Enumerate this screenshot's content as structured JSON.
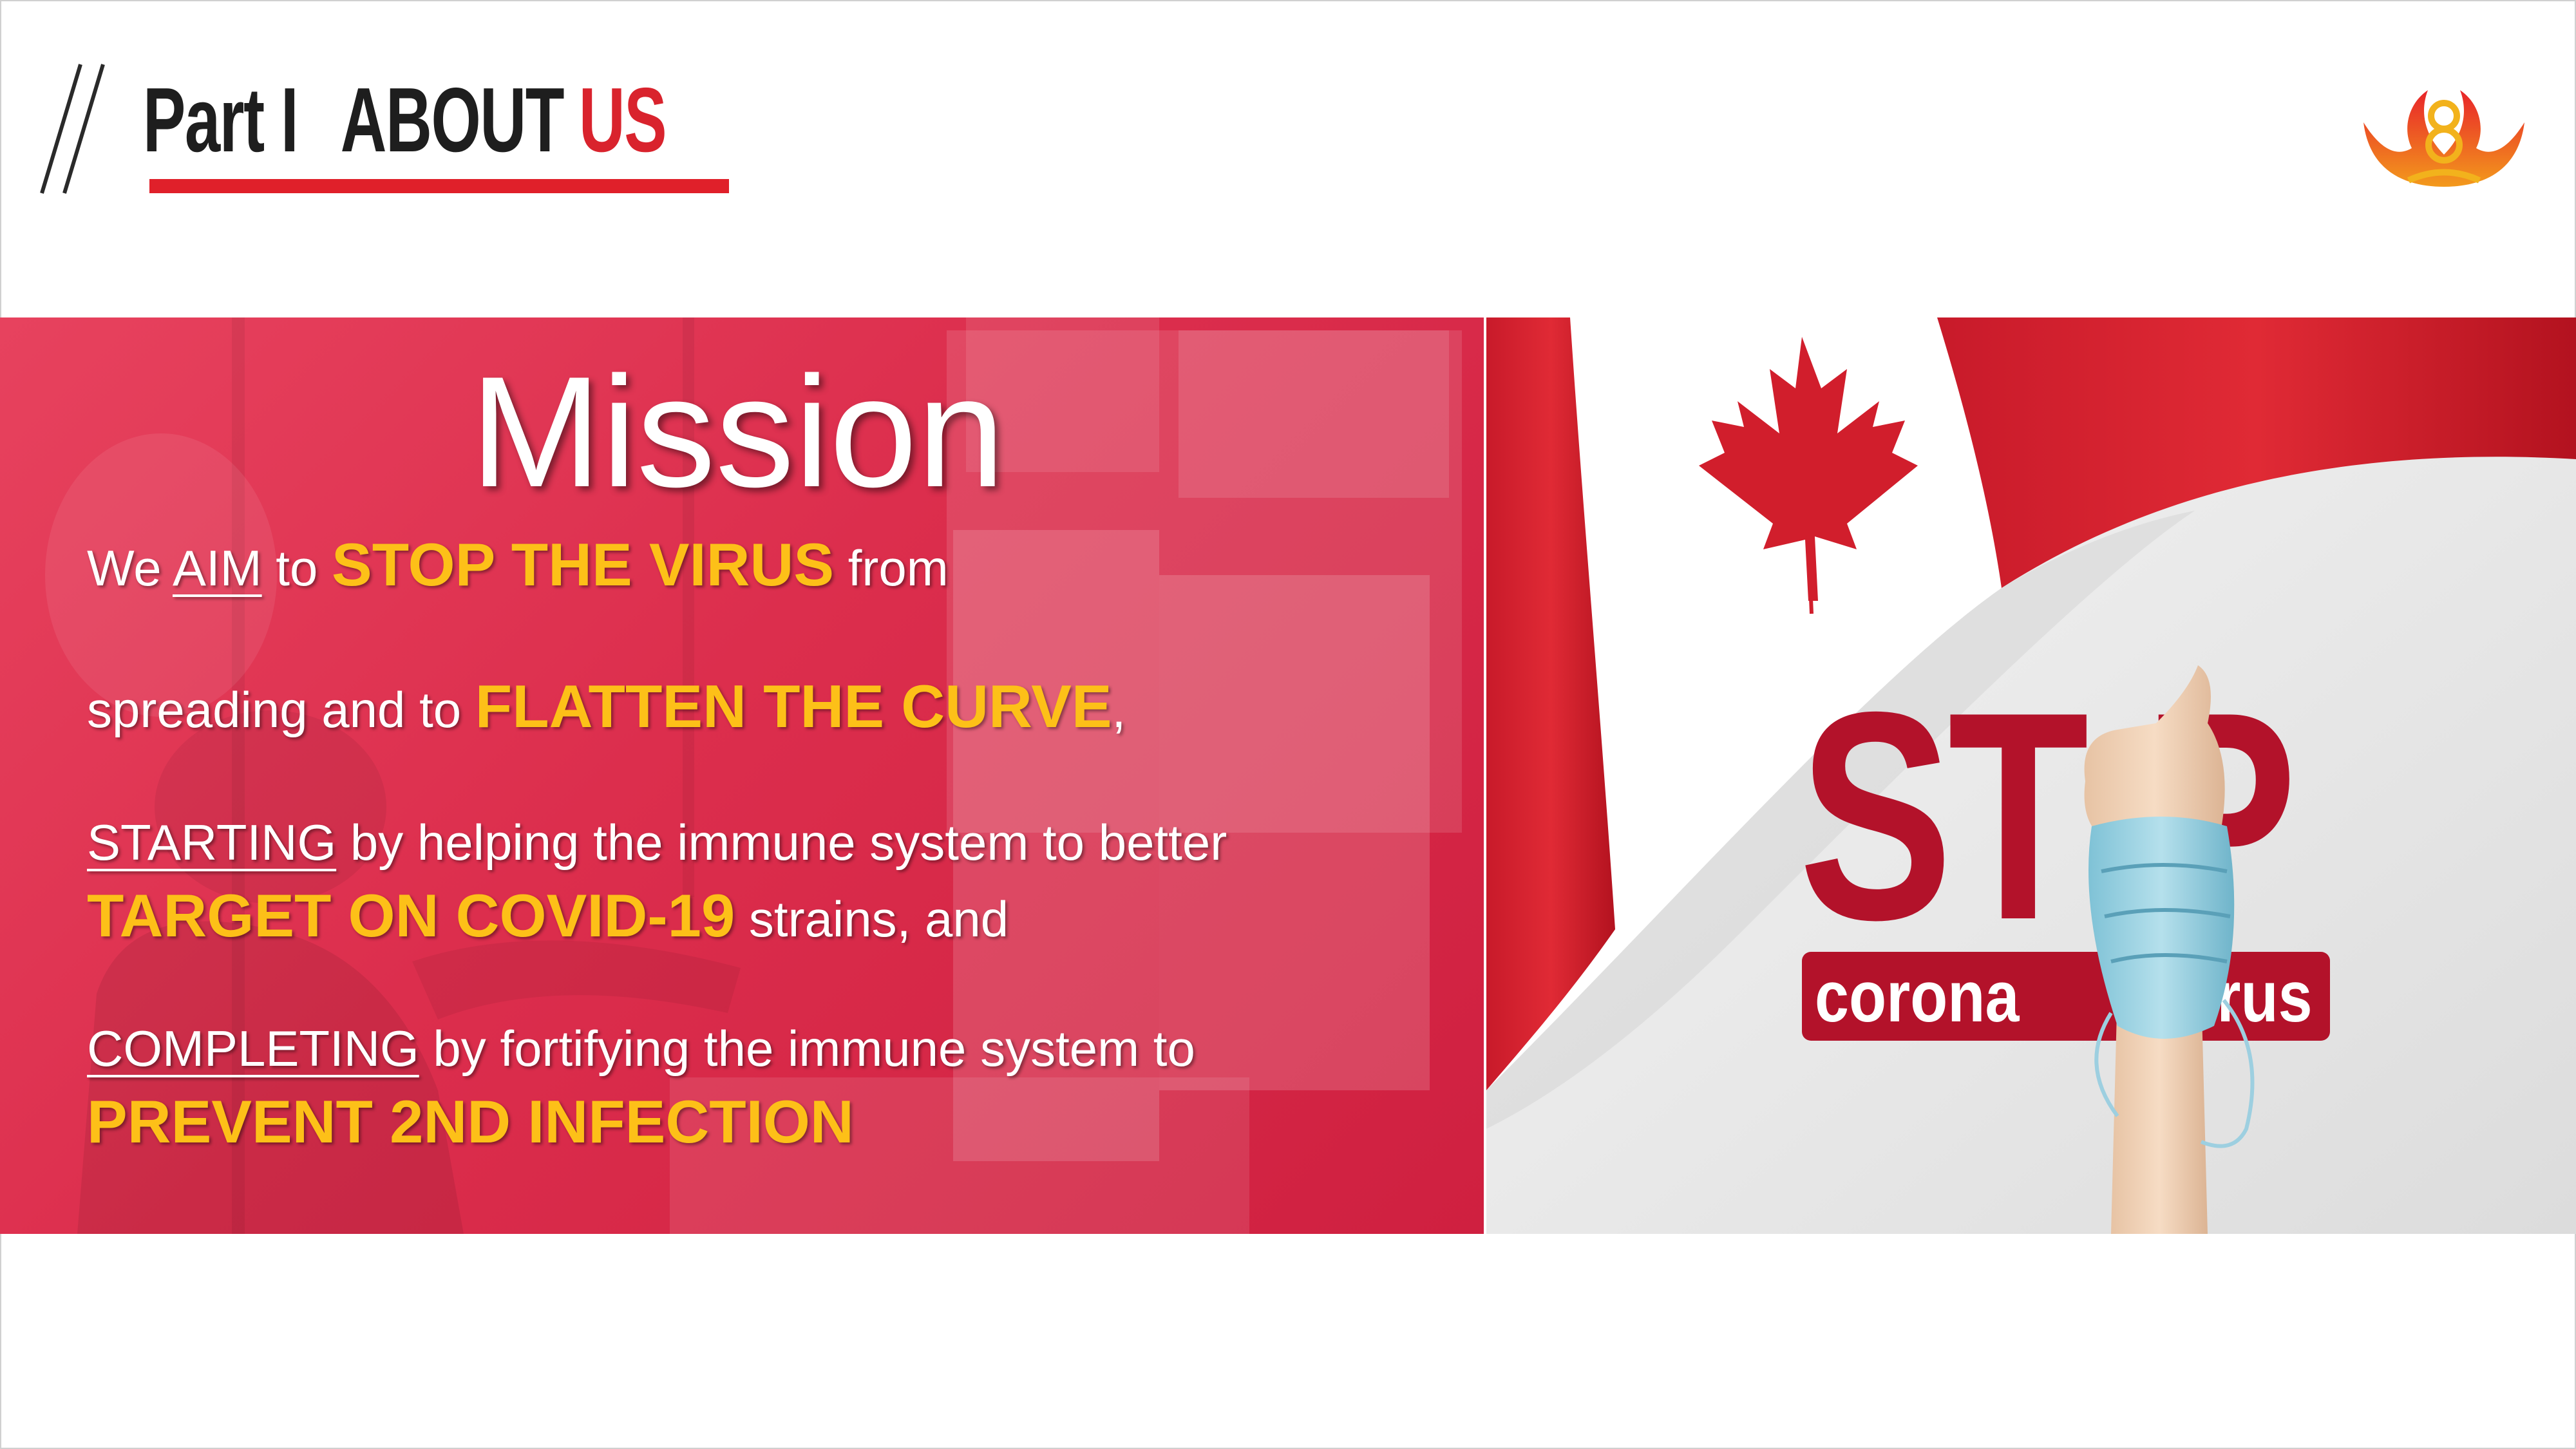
{
  "header": {
    "part_label": "Part I",
    "about_label": "ABOUT",
    "us_label": "US",
    "logo_icon": "lotus-logo-icon"
  },
  "mission": {
    "title": "Mission",
    "line1": {
      "pre": "We ",
      "aim": "AIM",
      "mid": " to ",
      "highlight": "STOP THE VIRUS",
      "post": " from"
    },
    "line2": {
      "pre": "spreading and to ",
      "highlight": "FLATTEN THE CURVE",
      "post": ","
    },
    "line3": {
      "ul": "STARTING",
      "post": " by helping the immune system to better"
    },
    "line4": {
      "highlight": "TARGET ON COVID-19",
      "post": " strains, and"
    },
    "line5": {
      "ul": "COMPLETING",
      "post": " by fortifying the immune system to"
    },
    "line6": {
      "highlight": "PREVENT 2ND INFECTION"
    }
  },
  "stop_graphic": {
    "stop_text": "ST P",
    "corona_text": "corona",
    "virus_text": "virus"
  },
  "colors": {
    "accent_red": "#e0202a",
    "highlight_yellow": "#fdc018",
    "stop_red": "#b3122a"
  }
}
